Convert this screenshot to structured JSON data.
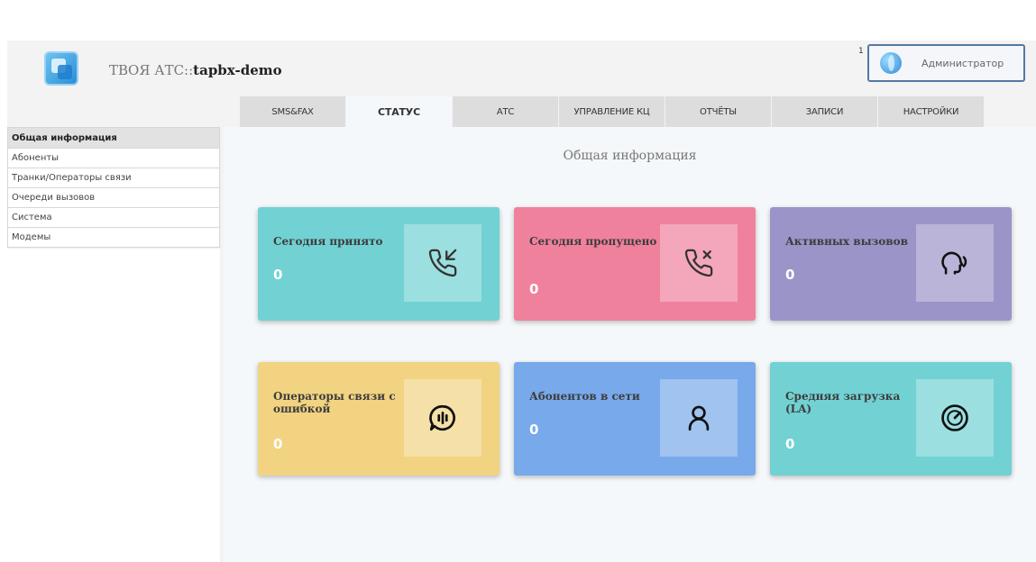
{
  "header": {
    "brand_prefix": "ТВОЯ АТС::",
    "brand_name": "tapbx-demo",
    "notification_count": "1",
    "user_name": "Администратор"
  },
  "tabs": [
    {
      "label": "SMS&FAX"
    },
    {
      "label": "СТАТУС",
      "active": true
    },
    {
      "label": "АТС"
    },
    {
      "label": "УПРАВЛЕНИЕ КЦ"
    },
    {
      "label": "ОТЧЁТЫ"
    },
    {
      "label": "ЗАПИСИ"
    },
    {
      "label": "НАСТРОЙКИ"
    }
  ],
  "sidebar": {
    "items": [
      {
        "label": "Общая информация",
        "active": true
      },
      {
        "label": "Абоненты"
      },
      {
        "label": "Транки/Операторы связи"
      },
      {
        "label": "Очереди вызовов"
      },
      {
        "label": "Система"
      },
      {
        "label": "Модемы"
      }
    ]
  },
  "main": {
    "title": "Общая информация",
    "cards": [
      {
        "label": "Сегодня принято",
        "value": "0",
        "icon": "phone-incoming-icon",
        "color": "#72d1d3"
      },
      {
        "label": "Сегодня пропущено",
        "value": "0",
        "icon": "phone-missed-icon",
        "color": "#f0819d"
      },
      {
        "label": "Активных вызовов",
        "value": "0",
        "icon": "speaking-head-icon",
        "color": "#9b94c8"
      },
      {
        "label": "Операторы связи с ошибкой",
        "value": "0",
        "icon": "audio-bubble-icon",
        "color": "#f1d381"
      },
      {
        "label": "Абонентов в сети",
        "value": "0",
        "icon": "user-icon",
        "color": "#78a9ea"
      },
      {
        "label": "Средняя загрузка (LA)",
        "value": "0",
        "icon": "gauge-icon",
        "color": "#72d1d3"
      }
    ]
  }
}
